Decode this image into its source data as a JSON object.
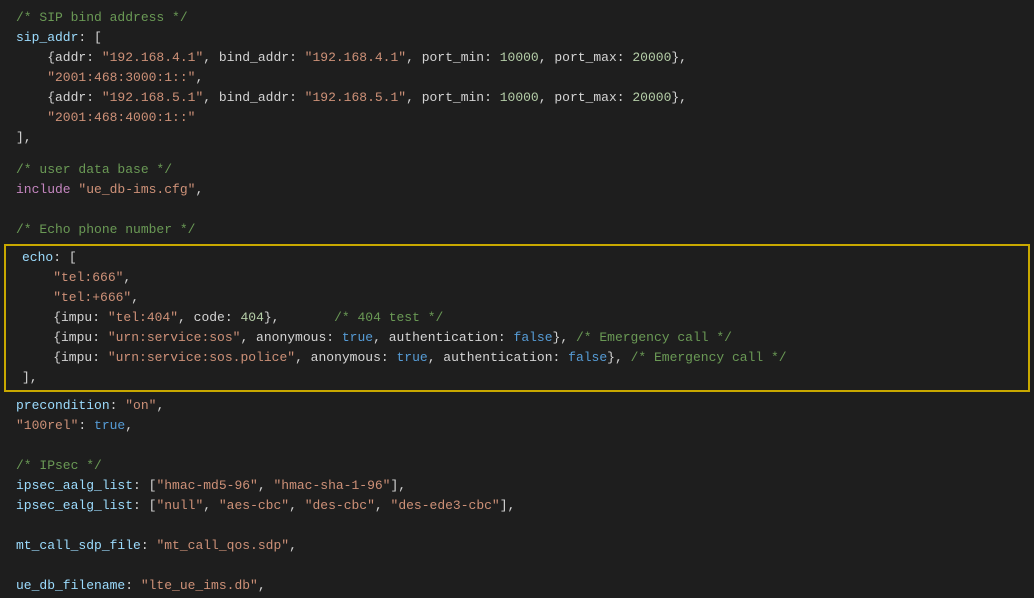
{
  "editor": {
    "background": "#1e1e1e",
    "sections": {
      "top": {
        "lines": [
          {
            "tokens": [
              {
                "type": "comment",
                "text": "/* SIP bind address */"
              }
            ]
          },
          {
            "tokens": [
              {
                "type": "key",
                "text": "sip_addr"
              },
              {
                "type": "punct",
                "text": ": ["
              }
            ]
          },
          {
            "tokens": [
              {
                "type": "punct",
                "text": "    {addr: "
              },
              {
                "type": "string",
                "text": "\"192.168.4.1\""
              },
              {
                "type": "punct",
                "text": ", bind_addr: "
              },
              {
                "type": "string",
                "text": "\"192.168.4.1\""
              },
              {
                "type": "punct",
                "text": ", port_min: "
              },
              {
                "type": "number",
                "text": "10000"
              },
              {
                "type": "punct",
                "text": ", port_max: "
              },
              {
                "type": "number",
                "text": "20000"
              },
              {
                "type": "punct",
                "text": "},"
              }
            ]
          },
          {
            "tokens": [
              {
                "type": "string",
                "text": "    \"2001:468:3000:1::\""
              }
            ],
            "suffix": ","
          },
          {
            "tokens": [
              {
                "type": "punct",
                "text": "    {addr: "
              },
              {
                "type": "string",
                "text": "\"192.168.5.1\""
              },
              {
                "type": "punct",
                "text": ", bind_addr: "
              },
              {
                "type": "string",
                "text": "\"192.168.5.1\""
              },
              {
                "type": "punct",
                "text": ", port_min: "
              },
              {
                "type": "number",
                "text": "10000"
              },
              {
                "type": "punct",
                "text": ", port_max: "
              },
              {
                "type": "number",
                "text": "20000"
              },
              {
                "type": "punct",
                "text": "},"
              }
            ]
          },
          {
            "tokens": [
              {
                "type": "string",
                "text": "    \"2001:468:4000:1::\""
              }
            ]
          },
          {
            "tokens": [
              {
                "type": "punct",
                "text": "],"
              }
            ]
          }
        ]
      },
      "middle": {
        "lines": [
          {
            "tokens": [
              {
                "type": "comment",
                "text": "/* user data base */"
              }
            ]
          },
          {
            "tokens": [
              {
                "type": "keyword",
                "text": "include"
              },
              {
                "type": "punct",
                "text": " "
              },
              {
                "type": "string",
                "text": "\"ue_db-ims.cfg\""
              },
              {
                "type": "punct",
                "text": ","
              }
            ]
          }
        ]
      },
      "echo_comment": {
        "lines": [
          {
            "tokens": [
              {
                "type": "comment",
                "text": "/* Echo phone number */"
              }
            ]
          }
        ]
      },
      "highlighted": {
        "lines": [
          {
            "tokens": [
              {
                "type": "key",
                "text": "echo"
              },
              {
                "type": "punct",
                "text": ": ["
              }
            ]
          },
          {
            "tokens": [
              {
                "type": "string",
                "text": "    \"tel:666\""
              }
            ],
            "suffix": ","
          },
          {
            "tokens": [
              {
                "type": "string",
                "text": "    \"tel:+666\""
              }
            ],
            "suffix": ","
          },
          {
            "tokens": [
              {
                "type": "punct",
                "text": "    {impu: "
              },
              {
                "type": "string",
                "text": "\"tel:404\""
              },
              {
                "type": "punct",
                "text": ", code: "
              },
              {
                "type": "number",
                "text": "404"
              },
              {
                "type": "punct",
                "text": "},       "
              },
              {
                "type": "comment",
                "text": "/* 404 test */"
              }
            ]
          },
          {
            "tokens": [
              {
                "type": "punct",
                "text": "    {impu: "
              },
              {
                "type": "string",
                "text": "\"urn:service:sos\""
              },
              {
                "type": "punct",
                "text": ", anonymous: "
              },
              {
                "type": "bool",
                "text": "true"
              },
              {
                "type": "punct",
                "text": ", authentication: "
              },
              {
                "type": "bool",
                "text": "false"
              },
              {
                "type": "punct",
                "text": "}, "
              },
              {
                "type": "comment",
                "text": "/* Emergency call */"
              }
            ]
          },
          {
            "tokens": [
              {
                "type": "punct",
                "text": "    {impu: "
              },
              {
                "type": "string",
                "text": "\"urn:service:sos.police\""
              },
              {
                "type": "punct",
                "text": ", anonymous: "
              },
              {
                "type": "bool",
                "text": "true"
              },
              {
                "type": "punct",
                "text": ", authentication: "
              },
              {
                "type": "bool",
                "text": "false"
              },
              {
                "type": "punct",
                "text": "}, "
              },
              {
                "type": "comment",
                "text": "/* Emergency call */"
              }
            ]
          },
          {
            "tokens": [
              {
                "type": "punct",
                "text": "],"
              }
            ]
          }
        ]
      },
      "bottom": {
        "lines": [
          {
            "tokens": [
              {
                "type": "key",
                "text": "precondition"
              },
              {
                "type": "punct",
                "text": ": "
              },
              {
                "type": "string",
                "text": "\"on\""
              },
              {
                "type": "punct",
                "text": ","
              }
            ]
          },
          {
            "tokens": [
              {
                "type": "string",
                "text": "\"100rel\""
              },
              {
                "type": "punct",
                "text": ": "
              },
              {
                "type": "bool",
                "text": "true"
              },
              {
                "type": "punct",
                "text": ","
              }
            ]
          },
          {
            "tokens": []
          },
          {
            "tokens": [
              {
                "type": "comment",
                "text": "/* IPsec */"
              }
            ]
          },
          {
            "tokens": [
              {
                "type": "key",
                "text": "ipsec_aalg_list"
              },
              {
                "type": "punct",
                "text": ": ["
              },
              {
                "type": "string",
                "text": "\"hmac-md5-96\""
              },
              {
                "type": "punct",
                "text": ", "
              },
              {
                "type": "string",
                "text": "\"hmac-sha-1-96\""
              },
              {
                "type": "punct",
                "text": "],"
              }
            ]
          },
          {
            "tokens": [
              {
                "type": "key",
                "text": "ipsec_ealg_list"
              },
              {
                "type": "punct",
                "text": ": ["
              },
              {
                "type": "string",
                "text": "\"null\""
              },
              {
                "type": "punct",
                "text": ", "
              },
              {
                "type": "string",
                "text": "\"aes-cbc\""
              },
              {
                "type": "punct",
                "text": ", "
              },
              {
                "type": "string",
                "text": "\"des-cbc\""
              },
              {
                "type": "punct",
                "text": ", "
              },
              {
                "type": "string",
                "text": "\"des-ede3-cbc\""
              },
              {
                "type": "punct",
                "text": "],"
              }
            ]
          },
          {
            "tokens": []
          },
          {
            "tokens": [
              {
                "type": "key",
                "text": "mt_call_sdp_file"
              },
              {
                "type": "punct",
                "text": ": "
              },
              {
                "type": "string",
                "text": "\"mt_call_qos.sdp\""
              },
              {
                "type": "punct",
                "text": ","
              }
            ]
          },
          {
            "tokens": []
          },
          {
            "tokens": [
              {
                "type": "key",
                "text": "ue_db_filename"
              },
              {
                "type": "punct",
                "text": ": "
              },
              {
                "type": "string",
                "text": "\"lte_ue_ims.db\""
              },
              {
                "type": "punct",
                "text": ","
              }
            ]
          }
        ]
      }
    }
  }
}
